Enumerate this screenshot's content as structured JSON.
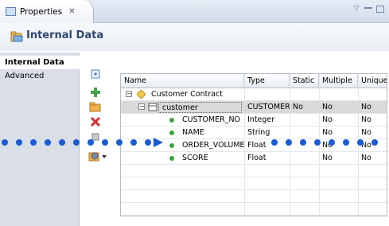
{
  "view_tab": {
    "label": "Properties",
    "close": "✕"
  },
  "page": {
    "title": "Internal Data"
  },
  "nav": {
    "items": [
      "Internal Data",
      "Advanced"
    ],
    "active": 0
  },
  "toolbar": {
    "buttons": [
      "collapse-all",
      "add",
      "open",
      "delete",
      "move-up",
      "move-down",
      "more"
    ]
  },
  "table": {
    "columns": [
      "Name",
      "Type",
      "Static",
      "Multiple",
      "Unique"
    ],
    "rows": [
      {
        "name": "Customer Contract",
        "type": "",
        "static": "",
        "multiple": "",
        "unique": "",
        "level": 0
      },
      {
        "name": "customer",
        "type": "CUSTOMER",
        "static": "No",
        "multiple": "No",
        "unique": "No",
        "level": 1
      },
      {
        "name": "CUSTOMER_NO",
        "type": "Integer",
        "static": "",
        "multiple": "No",
        "unique": "No",
        "level": 2
      },
      {
        "name": "NAME",
        "type": "String",
        "static": "",
        "multiple": "No",
        "unique": "No",
        "level": 2
      },
      {
        "name": "ORDER_VOLUME",
        "type": "Float",
        "static": "",
        "multiple": "No",
        "unique": "No",
        "level": 2
      },
      {
        "name": "SCORE",
        "type": "Float",
        "static": "",
        "multiple": "No",
        "unique": "No",
        "level": 2
      }
    ]
  },
  "colors": {
    "title": "#30466e",
    "dots": "#1a5bd6",
    "selected_row": "#d9d9d9"
  }
}
